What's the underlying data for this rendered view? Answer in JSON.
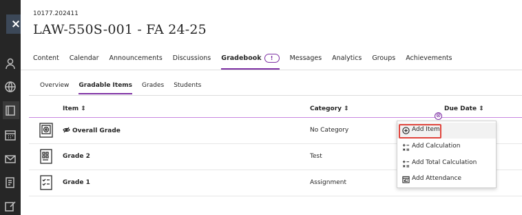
{
  "course": {
    "id": "10177.202411",
    "title": "LAW-550S-001 - FA 24-25"
  },
  "rail": {
    "close_label": "×",
    "icons": [
      "person-icon",
      "globe-icon",
      "courses-icon",
      "calendar-icon",
      "mail-icon",
      "grades-icon",
      "edit-icon"
    ]
  },
  "topnav": {
    "tabs": [
      "Content",
      "Calendar",
      "Announcements",
      "Discussions",
      "Gradebook",
      "Messages",
      "Analytics",
      "Groups",
      "Achievements"
    ],
    "active": "Gradebook",
    "gradebook_badge": "!"
  },
  "subnav": {
    "tabs": [
      "Overview",
      "Gradable Items",
      "Grades",
      "Students"
    ],
    "active": "Gradable Items"
  },
  "table": {
    "headers": {
      "item": "Item ⇕",
      "category": "Category ⇕",
      "due_date": "Due Date ⇕"
    },
    "rows": [
      {
        "name": "Overall Grade",
        "category": "No Category",
        "icon": "overall-grade-icon",
        "hidden": true
      },
      {
        "name": "Grade 2",
        "category": "Test",
        "icon": "test-icon",
        "hidden": false
      },
      {
        "name": "Grade 1",
        "category": "Assignment",
        "icon": "assignment-icon",
        "hidden": false
      }
    ]
  },
  "add_menu": {
    "toggle": "⊗",
    "items": [
      {
        "label": "Add Item",
        "icon": "plus-circle-icon"
      },
      {
        "label": "Add Calculation",
        "icon": "calculator-icon"
      },
      {
        "label": "Add Total Calculation",
        "icon": "calculator-icon"
      },
      {
        "label": "Add Attendance",
        "icon": "attendance-icon"
      }
    ]
  },
  "colors": {
    "accent": "#7d2fa3",
    "highlight_border": "#e0443c",
    "rail": "#262626"
  }
}
